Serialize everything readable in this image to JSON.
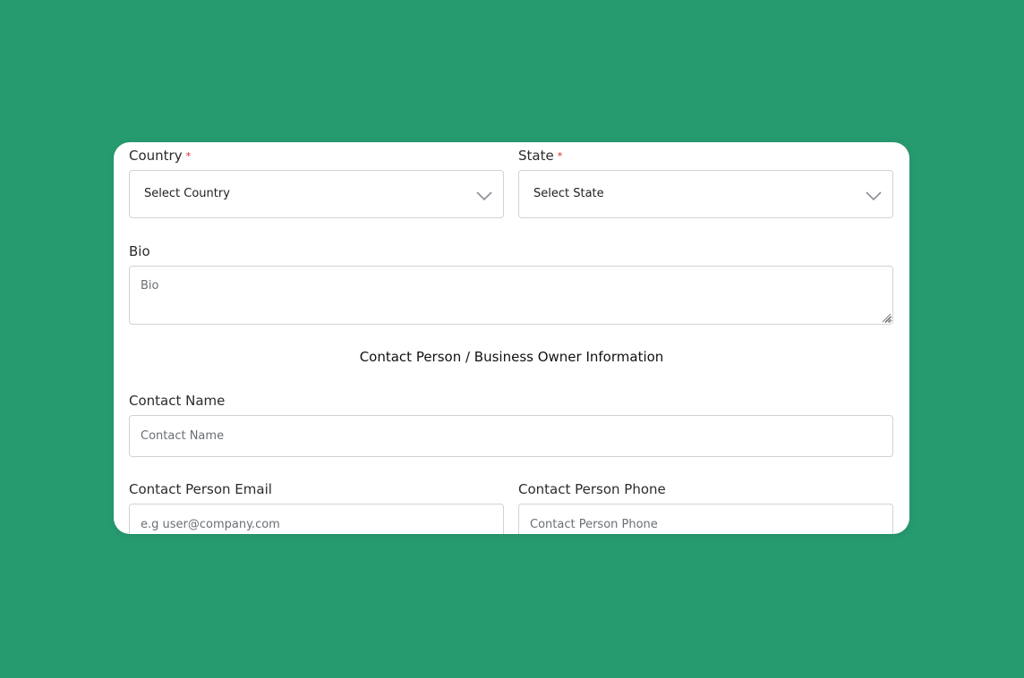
{
  "form": {
    "country": {
      "label": "Country",
      "required_mark": "*",
      "selected": "Select Country"
    },
    "state": {
      "label": "State",
      "required_mark": "*",
      "selected": "Select State"
    },
    "bio": {
      "label": "Bio",
      "placeholder": "Bio"
    },
    "section_title": "Contact Person / Business Owner Information",
    "contact_name": {
      "label": "Contact Name",
      "placeholder": "Contact Name"
    },
    "contact_email": {
      "label": "Contact Person Email",
      "placeholder": "e.g user@company.com"
    },
    "contact_phone": {
      "label": "Contact Person Phone",
      "placeholder": "Contact Person Phone"
    }
  },
  "colors": {
    "background": "#279b70",
    "required": "#e02424",
    "border": "#cfd3d8"
  },
  "icons": {
    "select_arrow": "chevron-down-icon",
    "textarea_resize": "resize-grip-icon"
  }
}
